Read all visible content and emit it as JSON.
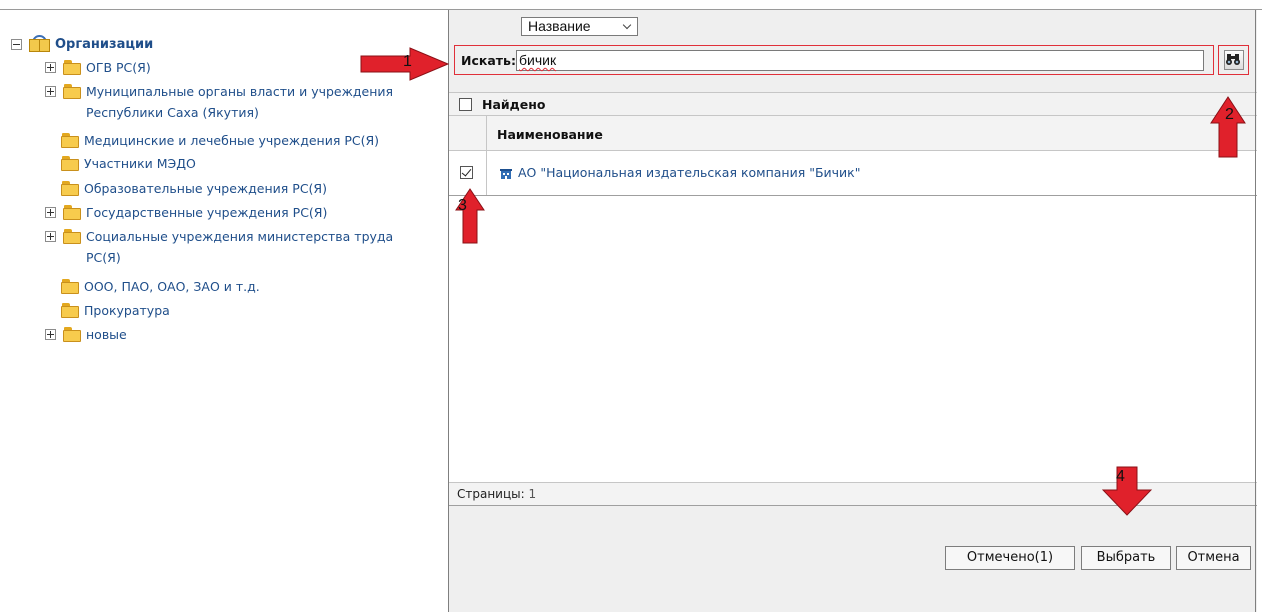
{
  "tree": {
    "root": {
      "label": "Организации",
      "icon": "book-icon"
    },
    "items": [
      {
        "label": "ОГВ РС(Я)",
        "expandable": true
      },
      {
        "label": "Муниципальные органы власти и учреждения Республики Саха (Якутия)",
        "expandable": true
      },
      {
        "label": "Медицинские и лечебные учреждения РС(Я)",
        "expandable": false
      },
      {
        "label": "Участники МЭДО",
        "expandable": false
      },
      {
        "label": "Образовательные учреждения РС(Я)",
        "expandable": false
      },
      {
        "label": "Государственные учреждения РС(Я)",
        "expandable": true
      },
      {
        "label": "Социальные учреждения министерства труда РС(Я)",
        "expandable": true
      },
      {
        "label": "ООО, ПАО, ОАО, ЗАО и т.д.",
        "expandable": false
      },
      {
        "label": "Прокуратура",
        "expandable": false
      },
      {
        "label": "новые",
        "expandable": true
      }
    ]
  },
  "search": {
    "field_select": "Название",
    "label": "Искать:",
    "value": "бичик",
    "button_icon": "binoculars-icon"
  },
  "results": {
    "found_label": "Найдено",
    "column_name": "Наименование",
    "rows": [
      {
        "name": "АО \"Национальная издательская компания \"Бичик\"",
        "checked": true,
        "icon": "organization-icon"
      }
    ]
  },
  "pager": {
    "label": "Страницы:",
    "value": "1"
  },
  "buttons": {
    "marked": "Отмечено(1)",
    "select": "Выбрать",
    "cancel": "Отмена"
  },
  "annotations": {
    "arrow1": "1",
    "arrow2": "2",
    "arrow3": "3",
    "arrow4": "4",
    "color": "#e0212b"
  },
  "colors": {
    "link_blue": "#1f4e8a",
    "highlight_red": "#e0303a",
    "panel_gray": "#efefef"
  }
}
